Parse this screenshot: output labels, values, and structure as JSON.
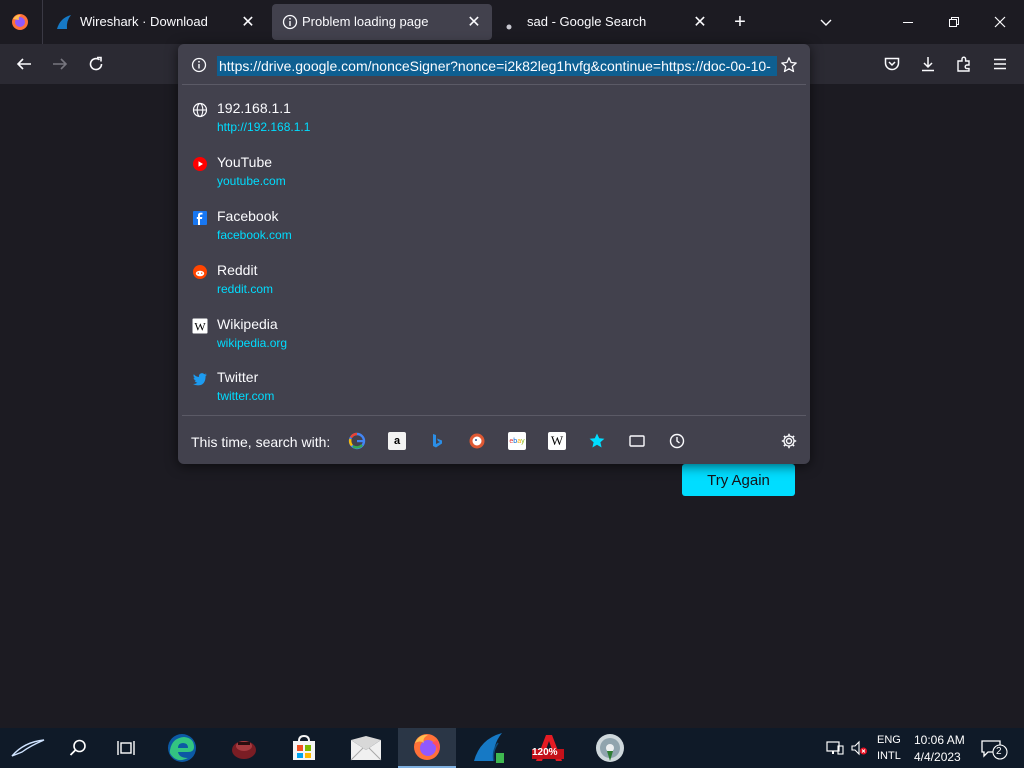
{
  "tabs": [
    {
      "title": "Wireshark · Download",
      "close": "✕"
    },
    {
      "title": "Problem loading page",
      "close": "✕"
    },
    {
      "title": "sad - Google Search",
      "close": "✕"
    }
  ],
  "tab_controls": {
    "new_tab": "+",
    "list_all": "⌄"
  },
  "window_controls": {
    "minimize": "—",
    "restore": "❐",
    "close": "✕"
  },
  "url": "https://drive.google.com/nonceSigner?nonce=i2k82leg1hvfg&continue=https://doc-0o-10-",
  "suggestions": [
    {
      "title": "192.168.1.1",
      "url": "http://192.168.1.1",
      "icon": "globe-icon"
    },
    {
      "title": "YouTube",
      "url": "youtube.com",
      "icon": "youtube-icon"
    },
    {
      "title": "Facebook",
      "url": "facebook.com",
      "icon": "facebook-icon"
    },
    {
      "title": "Reddit",
      "url": "reddit.com",
      "icon": "reddit-icon"
    },
    {
      "title": "Wikipedia",
      "url": "wikipedia.org",
      "icon": "wikipedia-icon"
    },
    {
      "title": "Twitter",
      "url": "twitter.com",
      "icon": "twitter-icon"
    }
  ],
  "search_with_label": "This time, search with:",
  "search_engines": [
    {
      "name": "google-icon",
      "glyph": "G"
    },
    {
      "name": "amazon-icon",
      "glyph": "a"
    },
    {
      "name": "bing-icon",
      "glyph": "b"
    },
    {
      "name": "duckduckgo-icon",
      "glyph": "D"
    },
    {
      "name": "ebay-icon",
      "glyph": "ebay"
    },
    {
      "name": "wikipedia-icon",
      "glyph": "W"
    },
    {
      "name": "bookmarks-icon",
      "glyph": "★"
    },
    {
      "name": "tabs-icon",
      "glyph": ""
    },
    {
      "name": "history-icon",
      "glyph": ""
    }
  ],
  "try_again": "Try Again",
  "tray": {
    "lang1": "ENG",
    "lang2": "INTL",
    "time": "10:06 AM",
    "date": "4/4/2023",
    "notifications": "2"
  },
  "taskbar_apps": [
    {
      "name": "edge-icon"
    },
    {
      "name": "app-icon"
    },
    {
      "name": "store-icon"
    },
    {
      "name": "mail-icon"
    },
    {
      "name": "firefox-icon"
    },
    {
      "name": "wireshark-icon"
    },
    {
      "name": "autocad-icon",
      "label": "120%"
    },
    {
      "name": "installer-icon"
    }
  ],
  "colors": {
    "accent": "#00ddff",
    "panel": "#42414d",
    "background": "#1c1b22"
  }
}
